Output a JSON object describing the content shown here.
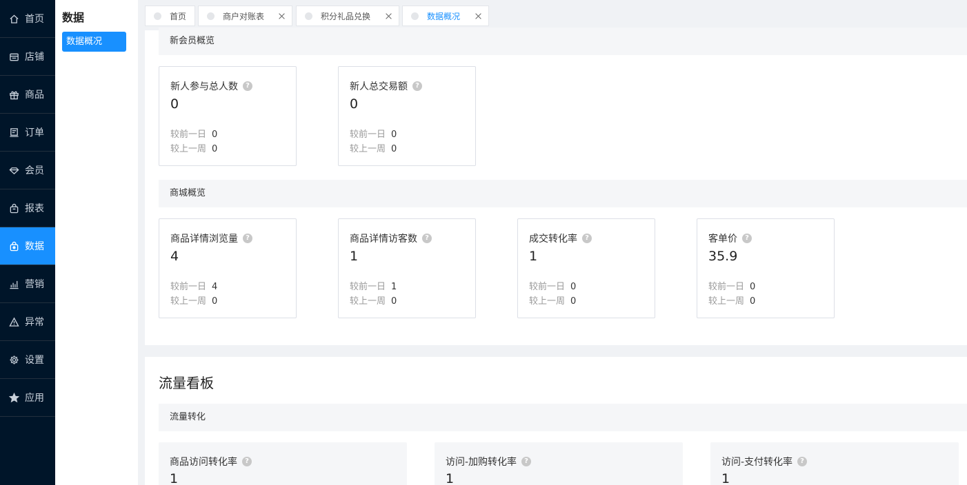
{
  "nav": [
    {
      "label": "首页",
      "icon": "home-icon"
    },
    {
      "label": "店铺",
      "icon": "store-icon"
    },
    {
      "label": "商品",
      "icon": "gift-icon"
    },
    {
      "label": "订单",
      "icon": "order-icon"
    },
    {
      "label": "会员",
      "icon": "diamond-icon"
    },
    {
      "label": "报表",
      "icon": "bag-icon"
    },
    {
      "label": "数据",
      "icon": "data-icon",
      "active": true
    },
    {
      "label": "营销",
      "icon": "bar-chart-icon"
    },
    {
      "label": "异常",
      "icon": "warning-icon"
    },
    {
      "label": "设置",
      "icon": "gear-icon"
    },
    {
      "label": "应用",
      "icon": "star-icon"
    }
  ],
  "subnav": {
    "title": "数据",
    "items": [
      {
        "label": "数据概况",
        "active": true
      }
    ]
  },
  "tabs": [
    {
      "label": "首页",
      "closable": false
    },
    {
      "label": "商户对账表",
      "closable": true
    },
    {
      "label": "积分礼品兑换",
      "closable": true
    },
    {
      "label": "数据概况",
      "closable": true,
      "active": true
    }
  ],
  "compare_day_label": "较前一日",
  "compare_week_label": "较上一周",
  "new_member": {
    "title": "新会员概览",
    "cards": [
      {
        "label": "新人参与总人数",
        "value": "0",
        "day": "0",
        "week": "0"
      },
      {
        "label": "新人总交易额",
        "value": "0",
        "day": "0",
        "week": "0"
      }
    ]
  },
  "mall": {
    "title": "商城概览",
    "cards": [
      {
        "label": "商品详情浏览量",
        "value": "4",
        "day": "4",
        "week": "0"
      },
      {
        "label": "商品详情访客数",
        "value": "1",
        "day": "1",
        "week": "0"
      },
      {
        "label": "成交转化率",
        "value": "1",
        "day": "0",
        "week": "0"
      },
      {
        "label": "客单价",
        "value": "35.9",
        "day": "0",
        "week": "0"
      }
    ]
  },
  "traffic": {
    "title": "流量看板",
    "section": "流量转化",
    "cards": [
      {
        "label": "商品访问转化率",
        "value": "1"
      },
      {
        "label": "访问-加购转化率",
        "value": "1"
      },
      {
        "label": "访问-支付转化率",
        "value": "1"
      }
    ]
  },
  "help_glyph": "?",
  "colors": {
    "accent": "#1890ff",
    "nav_bg": "#001529"
  }
}
